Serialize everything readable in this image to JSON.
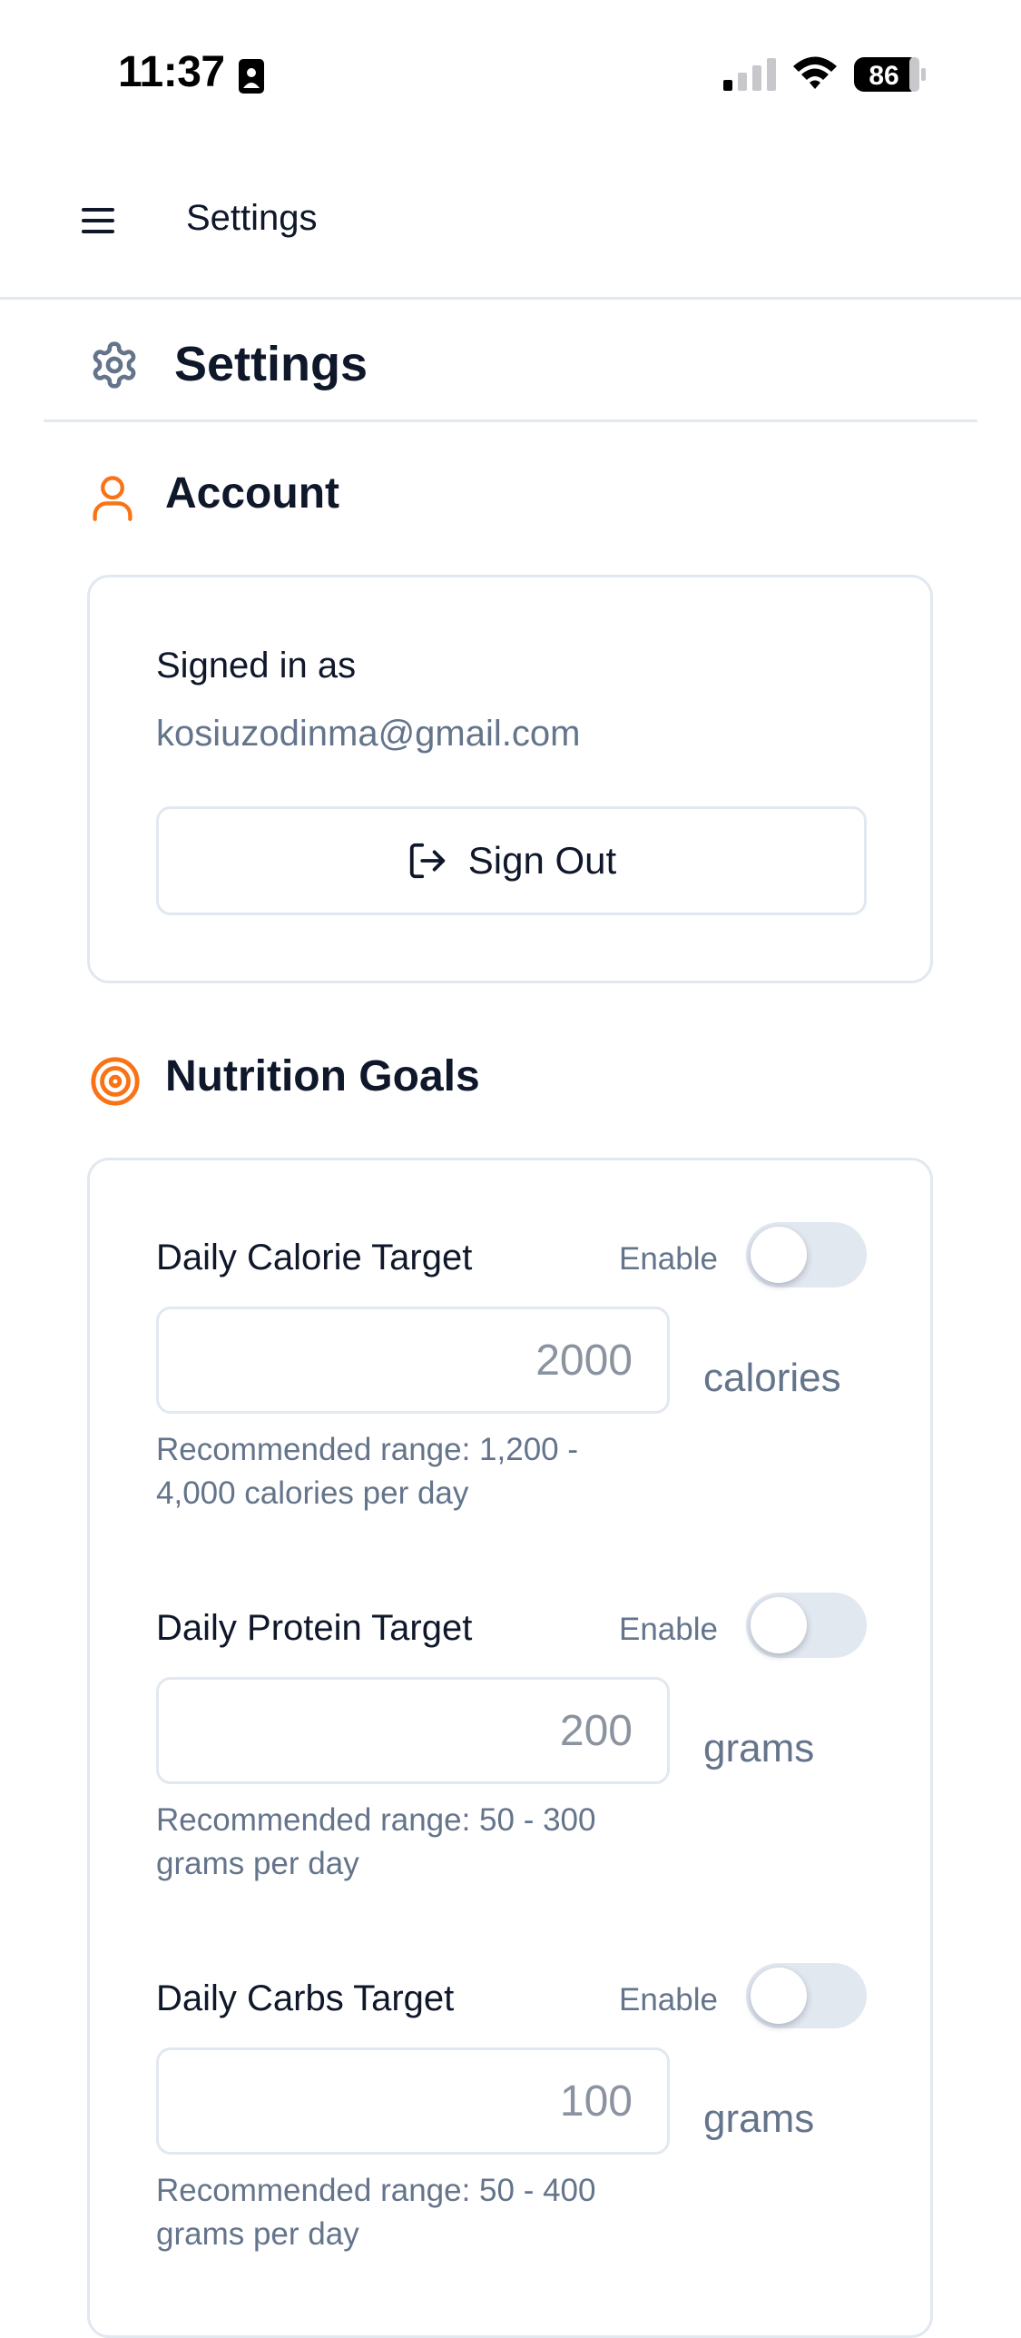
{
  "status_bar": {
    "time": "11:37",
    "battery": "86",
    "icons": [
      "id-card-icon",
      "signal-icon",
      "wifi-icon",
      "battery-icon"
    ]
  },
  "header": {
    "title": "Settings",
    "menu_icon": "hamburger-menu-icon"
  },
  "page": {
    "title": "Settings",
    "icon": "gear-icon"
  },
  "account": {
    "heading": "Account",
    "icon": "user-icon",
    "signed_in_label": "Signed in as",
    "email": "kosiuzodinma@gmail.com",
    "sign_out_label": "Sign Out",
    "sign_out_icon": "logout-icon"
  },
  "nutrition": {
    "heading": "Nutrition Goals",
    "icon": "target-icon",
    "goals": [
      {
        "label": "Daily Calorie Target",
        "enable_label": "Enable",
        "enabled": false,
        "placeholder": "2000",
        "unit": "calories",
        "hint": "Recommended range: 1,200 - 4,000 calories per day"
      },
      {
        "label": "Daily Protein Target",
        "enable_label": "Enable",
        "enabled": false,
        "placeholder": "200",
        "unit": "grams",
        "hint": "Recommended range: 50 - 300 grams per day"
      },
      {
        "label": "Daily Carbs Target",
        "enable_label": "Enable",
        "enabled": false,
        "placeholder": "100",
        "unit": "grams",
        "hint": "Recommended range: 50 - 400 grams per day"
      }
    ]
  },
  "colors": {
    "accent": "#f97316",
    "text": "#0f172a",
    "muted": "#64748b",
    "border": "#e2e8f0",
    "toggle_off": "#e2e8f0"
  }
}
